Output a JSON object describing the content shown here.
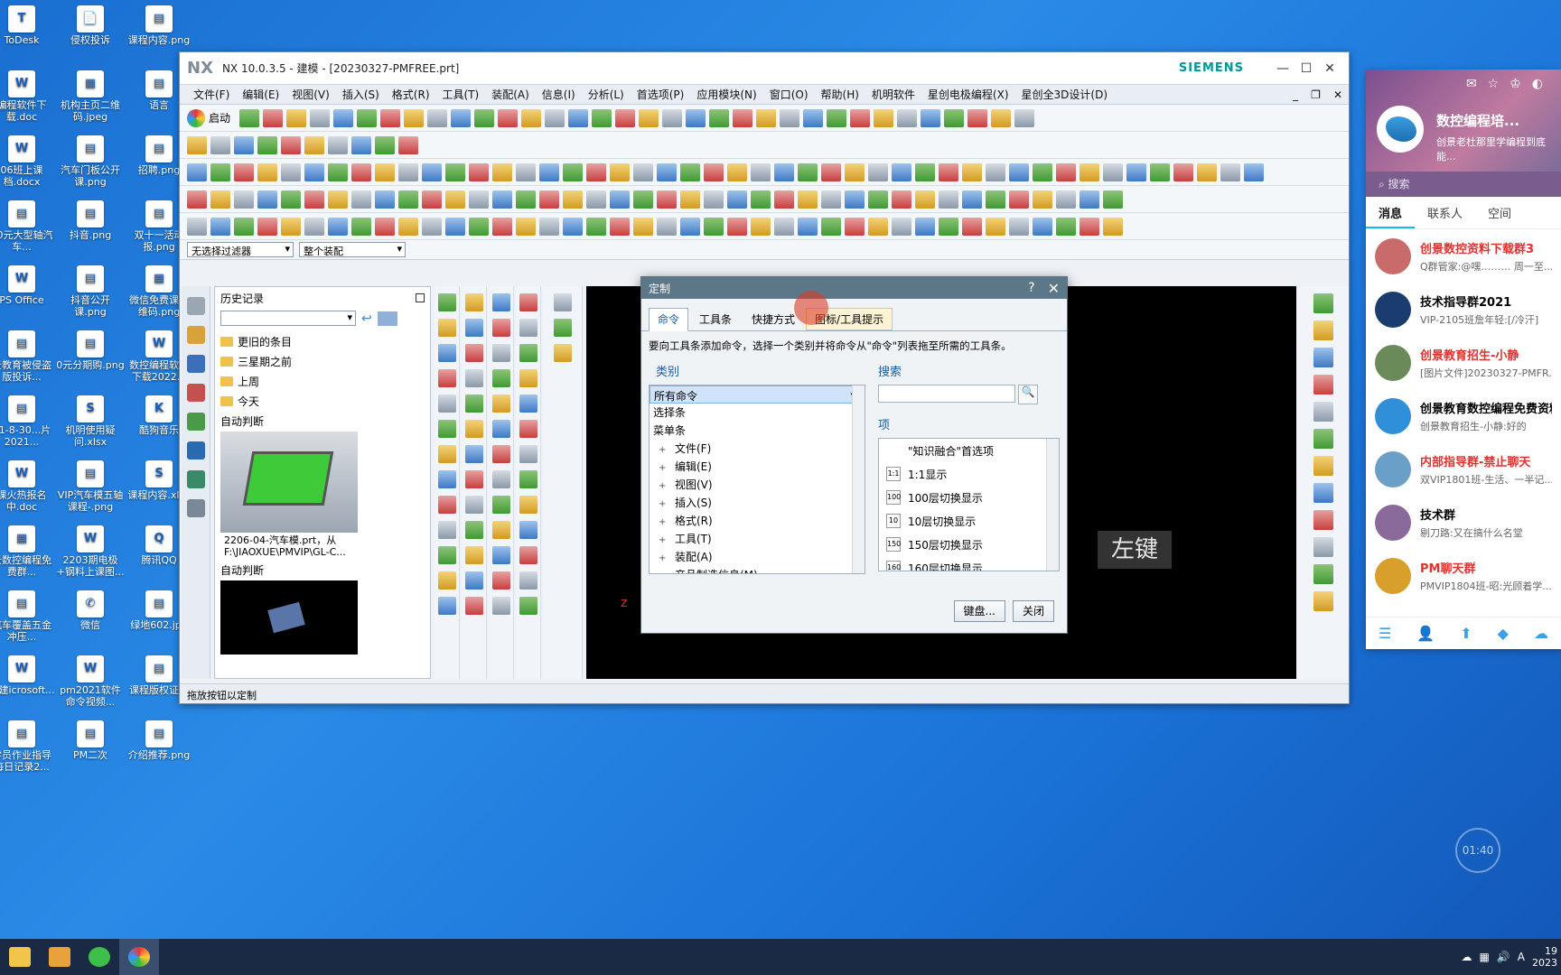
{
  "desktop": {
    "icons": [
      {
        "label": "ToDesk",
        "glyph": "T"
      },
      {
        "label": "侵权投诉",
        "glyph": "📄"
      },
      {
        "label": "课程内容.png",
        "glyph": "▤"
      },
      {
        "label": "编程软件下载.doc",
        "glyph": "W"
      },
      {
        "label": "机构主页二维码.jpeg",
        "glyph": "▦"
      },
      {
        "label": "语言",
        "glyph": "▤"
      },
      {
        "label": "06班上课档.docx",
        "glyph": "W"
      },
      {
        "label": "汽车门板公开课.png",
        "glyph": "▤"
      },
      {
        "label": "招聘.png",
        "glyph": "▤"
      },
      {
        "label": "00元大型轴汽车...",
        "glyph": "▤"
      },
      {
        "label": "抖音.png",
        "glyph": "▤"
      },
      {
        "label": "双十一活动报.png",
        "glyph": "▤"
      },
      {
        "label": "PS Office",
        "glyph": "W"
      },
      {
        "label": "抖音公开课.png",
        "glyph": "▤"
      },
      {
        "label": "微信免费课二维码.png",
        "glyph": "▦"
      },
      {
        "label": "景教育被侵盗版投诉...",
        "glyph": "▤"
      },
      {
        "label": "0元分期购.png",
        "glyph": "▤"
      },
      {
        "label": "数控编程软件下载2022...",
        "glyph": "W"
      },
      {
        "label": "21-8-30...片2021...",
        "glyph": "▤"
      },
      {
        "label": "机明使用疑问.xlsx",
        "glyph": "S"
      },
      {
        "label": "酷狗音乐",
        "glyph": "K"
      },
      {
        "label": "课火热报名中.doc",
        "glyph": "W"
      },
      {
        "label": "VIP汽车模五轴课程-.png",
        "glyph": "▤"
      },
      {
        "label": "课程内容.xlsx",
        "glyph": "S"
      },
      {
        "label": "景数控编程免费群...",
        "glyph": "▦"
      },
      {
        "label": "2203期电极+钢料上课图...",
        "glyph": "W"
      },
      {
        "label": "腾讯QQ",
        "glyph": "Q"
      },
      {
        "label": "汽车覆盖五金冲压...",
        "glyph": "▤"
      },
      {
        "label": "微信",
        "glyph": "✆"
      },
      {
        "label": "绿地602.jpg",
        "glyph": "▤"
      },
      {
        "label": "新建icrosoft...",
        "glyph": "W"
      },
      {
        "label": "pm2021软件命令视频...",
        "glyph": "W"
      },
      {
        "label": "课程版权证书",
        "glyph": "▤"
      },
      {
        "label": "学员作业指导每日记录2...",
        "glyph": "▤"
      },
      {
        "label": "PM二次",
        "glyph": "▤"
      },
      {
        "label": "介绍推荐.png",
        "glyph": "▤"
      }
    ]
  },
  "nx": {
    "logo": "NX",
    "title": "NX 10.0.3.5 - 建模 - [20230327-PMFREE.prt]",
    "brand": "SIEMENS",
    "win_min": "—",
    "win_max": "☐",
    "win_close": "✕",
    "menu": [
      "文件(F)",
      "编辑(E)",
      "视图(V)",
      "插入(S)",
      "格式(R)",
      "工具(T)",
      "装配(A)",
      "信息(I)",
      "分析(L)",
      "首选项(P)",
      "应用模块(N)",
      "窗口(O)",
      "帮助(H)",
      "机明软件",
      "星创电极编程(X)",
      "星创全3D设计(D)"
    ],
    "start_label": "启动",
    "filter_select": "无选择过滤器",
    "assembly_select": "整个装配",
    "history": {
      "title": "历史记录",
      "folders": [
        "更旧的条目",
        "三星期之前",
        "上周",
        "今天"
      ],
      "auto_label_1": "自动判断",
      "thumb_caption": "2206-04-汽车模.prt，从F:\\JIAOXUE\\PMVIP\\GL-C...",
      "auto_label_2": "自动判断"
    },
    "viewport_hint": "左键",
    "axis_label": "Z",
    "status_text": "拖放按钮以定制"
  },
  "dialog": {
    "title": "定制",
    "help": "?",
    "close": "✕",
    "tabs": [
      "命令",
      "工具条",
      "快捷方式",
      "图标/工具提示"
    ],
    "instruction": "要向工具条添加命令，选择一个类别并将命令从\"命令\"列表拖至所需的工具条。",
    "category_title": "类别",
    "categories": [
      "所有命令",
      "选择条",
      "菜单条",
      "文件(F)",
      "编辑(E)",
      "视图(V)",
      "插入(S)",
      "格式(R)",
      "工具(T)",
      "装配(A)",
      "产品制造信息(M)"
    ],
    "search_title": "搜索",
    "search_btn": "🔍",
    "items_title": "项",
    "items": [
      {
        "icon": "",
        "label": "\"知识融合\"首选项"
      },
      {
        "icon": "1:1",
        "label": "1:1显示"
      },
      {
        "icon": "100",
        "label": "100层切换显示"
      },
      {
        "icon": "10",
        "label": "10层切换显示"
      },
      {
        "icon": "150",
        "label": "150层切换显示"
      },
      {
        "icon": "160",
        "label": "160层切换显示"
      }
    ],
    "keyboard_btn": "键盘...",
    "close_btn": "关闭"
  },
  "qq": {
    "nickname": "数控编程培...",
    "signature": "创景老杜那里学编程到底能...",
    "search_placeholder": "搜索",
    "tabs": [
      "消息",
      "联系人",
      "空间"
    ],
    "chats": [
      {
        "name": "创景数控资料下载群3",
        "msg": "Q群管家:@嘿……… 周一至...",
        "red": true,
        "color": "#c96b6b"
      },
      {
        "name": "技术指导群2021",
        "msg": "VIP-2105班詹年轻:[/冷汗]",
        "red": false,
        "color": "#1a3c6e"
      },
      {
        "name": "创景教育招生-小静",
        "msg": "[图片文件]20230327-PMFR...",
        "red": true,
        "color": "#6a8a5a"
      },
      {
        "name": "创景教育数控编程免费资料",
        "msg": "创景教育招生-小静:好的",
        "red": false,
        "color": "#2f8fd8"
      },
      {
        "name": "内部指导群-禁止聊天",
        "msg": "双VIP1801班-生活、一半记...",
        "red": true,
        "color": "#6aa0c8"
      },
      {
        "name": "技术群",
        "msg": "剔刀路:又在搞什么名堂",
        "red": false,
        "color": "#8a6a9a"
      },
      {
        "name": "PM聊天群",
        "msg": "PMVIP1804班-昭:光顾着学...",
        "red": true,
        "color": "#d8a02a"
      }
    ]
  },
  "timer": "01:40",
  "taskbar": {
    "time": "19",
    "date": "2023"
  }
}
